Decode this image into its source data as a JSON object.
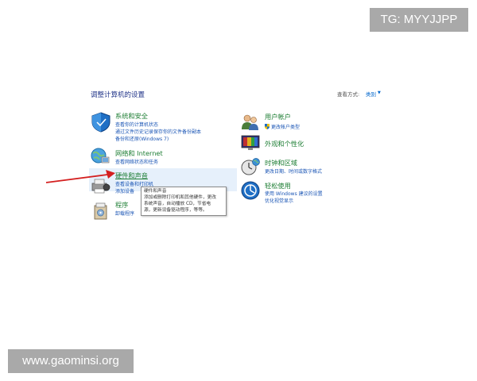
{
  "watermarks": {
    "top": "TG: MYYJJPP",
    "bottom": "www.gaominsi.org"
  },
  "page": {
    "title": "调整计算机的设置",
    "view_by_label": "查看方式:",
    "view_by_value": "类别"
  },
  "left_categories": [
    {
      "title": "系统和安全",
      "links": [
        "查看你的计算机状态",
        "通过文件历史记录保存你的文件备份副本",
        "备份和还原(Windows 7)"
      ]
    },
    {
      "title": "网络和 Internet",
      "links": [
        "查看网络状态和任务"
      ]
    },
    {
      "title": "硬件和声音",
      "links": [
        "查看设备和打印机",
        "添加设备"
      ]
    },
    {
      "title": "程序",
      "links": [
        "卸载程序"
      ]
    }
  ],
  "right_categories": [
    {
      "title": "用户帐户",
      "links": [
        "更改帐户类型"
      ]
    },
    {
      "title": "外观和个性化",
      "links": []
    },
    {
      "title": "时钟和区域",
      "links": [
        "更改日期、时间或数字格式"
      ]
    },
    {
      "title": "轻松使用",
      "links": [
        "使用 Windows 建议的设置",
        "优化视觉显示"
      ]
    }
  ],
  "tooltip": {
    "lines": [
      "硬件和声音",
      "添加或删除打印机和其他硬件，更改",
      "系统声音，自动播放 CD，节省电",
      "源，更新设备驱动程序，等等。"
    ]
  },
  "colors": {
    "category_title": "#1e7e34",
    "link": "#1a55b5",
    "title": "#1e3287",
    "arrow": "#d42020",
    "hover": "#e6f0fb"
  }
}
